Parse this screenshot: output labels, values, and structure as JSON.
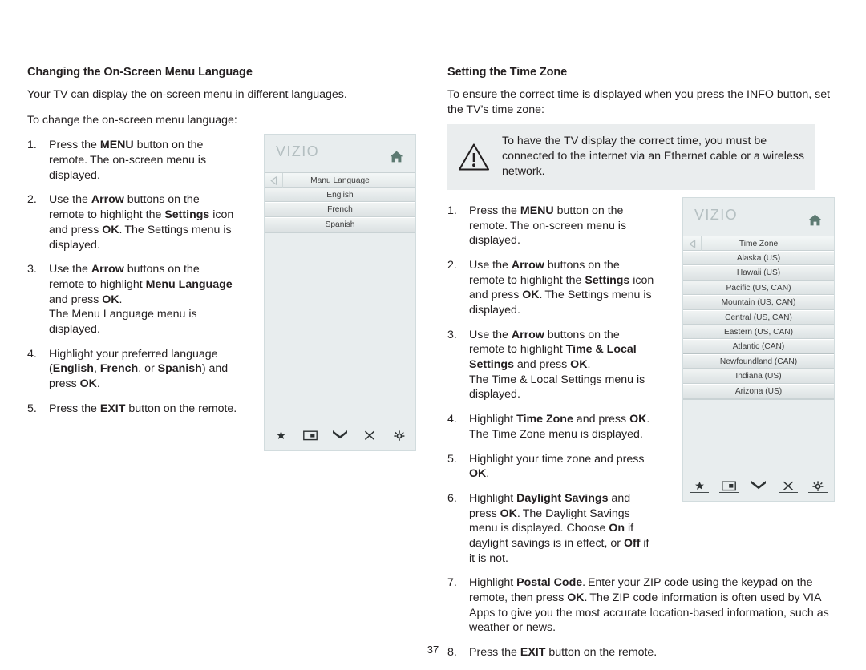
{
  "page": {
    "number": "37"
  },
  "left_column": {
    "title": "Changing the On-Screen Menu Language",
    "intro": "Your TV can display the on-screen menu in different languages.",
    "lead_in": "To change the on-screen menu language:",
    "steps": [
      {
        "num": "1.",
        "html": "Press the <b>MENU</b> button on the remote. The on-screen menu is displayed."
      },
      {
        "num": "2.",
        "html": "Use the <b>Arrow</b> buttons on the remote to highlight the <b>Settings</b> icon and press <b>OK</b>. The Settings menu is displayed."
      },
      {
        "num": "3.",
        "html": "Use the <b>Arrow</b> buttons on the remote to highlight <b>Menu Language</b> and press <b>OK</b>.<br>The Menu Language menu is displayed."
      },
      {
        "num": "4.",
        "html": "Highlight your preferred language (<b>English</b>, <b>French</b>, or <b>Spanish</b>) and press <b>OK</b>."
      },
      {
        "num": "5.",
        "html": "Press the <b>EXIT</b> button on the remote."
      }
    ]
  },
  "right_column": {
    "title": "Setting the Time Zone",
    "intro": "To ensure the correct time is displayed when you press the INFO button, set the TV’s time zone:",
    "note": {
      "icon": "warning-triangle-icon",
      "text": "To have the TV display the correct time, you must be connected to the internet via an Ethernet cable or a wireless network."
    },
    "steps": [
      {
        "num": "1.",
        "html": "Press the <b>MENU</b> button on the remote. The on-screen menu is displayed."
      },
      {
        "num": "2.",
        "html": "Use the <b>Arrow</b> buttons on the remote to highlight the <b>Settings</b> icon and press <b>OK</b>. The Settings menu is displayed."
      },
      {
        "num": "3.",
        "html": "Use the <b>Arrow</b> buttons on the remote to highlight <b>Time &amp; Local Settings</b> and press <b>OK</b>.<br>The Time &amp; Local Settings menu is displayed."
      },
      {
        "num": "4.",
        "html": "Highlight <b>Time Zone</b> and press <b>OK</b>. The Time Zone menu is displayed."
      },
      {
        "num": "5.",
        "html": "Highlight your time zone and press <b>OK</b>."
      },
      {
        "num": "6.",
        "html": "Highlight <b>Daylight Savings</b> and press <b>OK</b>. The Daylight Savings menu is displayed. Choose <b>On</b> if daylight savings is in effect, or <b>Off</b> if it is not."
      }
    ],
    "steps_wide": [
      {
        "num": "7.",
        "html": "Highlight <b>Postal Code</b>. Enter your ZIP code using the keypad on the remote, then press <b>OK</b>. The ZIP code information is often used by VIA Apps to give you the most accurate location-based information, such as weather or news."
      },
      {
        "num": "8.",
        "html": "Press the <b>EXIT</b> button on the remote."
      }
    ]
  },
  "tv_language": {
    "brand": "VIZIO",
    "home_icon": "home-icon",
    "menu_title": "Manu Language",
    "back_icon": "back-arrow-icon",
    "items": [
      "English",
      "French",
      "Spanish"
    ],
    "footer_icons": [
      "star-icon",
      "picture-icon",
      "chevron-double-down-icon",
      "close-x-icon",
      "gear-icon"
    ]
  },
  "tv_timezone": {
    "brand": "VIZIO",
    "home_icon": "home-icon",
    "menu_title": "Time Zone",
    "back_icon": "back-arrow-icon",
    "items": [
      "Alaska (US)",
      "Hawaii (US)",
      "Pacific (US, CAN)",
      "Mountain (US, CAN)",
      "Central (US, CAN)",
      "Eastern (US, CAN)",
      "Atlantic (CAN)",
      "Newfoundland (CAN)",
      "Indiana (US)",
      "Arizona (US)"
    ],
    "footer_icons": [
      "star-icon",
      "picture-icon",
      "chevron-double-down-icon",
      "close-x-icon",
      "gear-icon"
    ]
  },
  "colors": {
    "page_bg": "#ffffff",
    "text": "#231f20",
    "osd_bg": "#e8edee",
    "osd_border": "#d2dcde",
    "note_bg": "#eaedee",
    "brand_gray": "#b4bfc1",
    "home_green": "#5d7a72"
  }
}
